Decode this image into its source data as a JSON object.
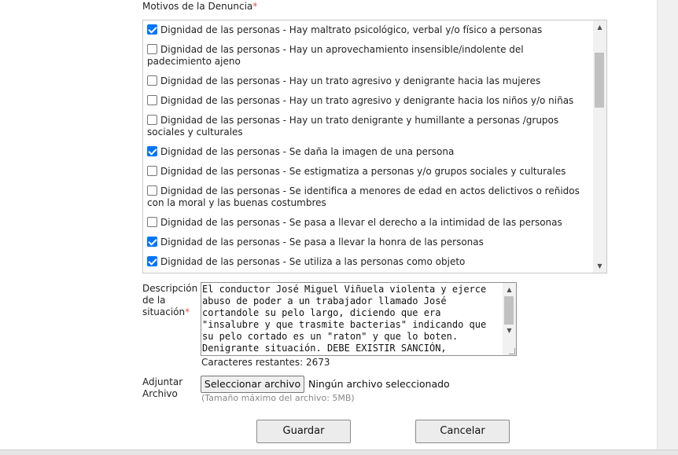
{
  "motivos": {
    "label": "Motivos de la Denuncia",
    "required_mark": "*",
    "items": [
      {
        "label": "Dignidad de las personas - Hay maltrato psicológico, verbal y/o físico a personas",
        "checked": true
      },
      {
        "label": "Dignidad de las personas - Hay un aprovechamiento insensible/indolente del padecimiento ajeno",
        "checked": false
      },
      {
        "label": "Dignidad de las personas - Hay un trato agresivo y denigrante hacia las mujeres",
        "checked": false
      },
      {
        "label": "Dignidad de las personas - Hay un trato agresivo y denigrante hacia los niños y/o niñas",
        "checked": false
      },
      {
        "label": "Dignidad de las personas - Hay un trato denigrante y humillante a personas /grupos sociales y culturales",
        "checked": false
      },
      {
        "label": "Dignidad de las personas - Se daña la imagen de una persona",
        "checked": true
      },
      {
        "label": "Dignidad de las personas - Se estigmatiza a personas y/o grupos sociales y culturales",
        "checked": false
      },
      {
        "label": "Dignidad de las personas - Se identifica a menores de edad en actos delictivos o reñidos con la moral y las buenas costumbres",
        "checked": false
      },
      {
        "label": "Dignidad de las personas - Se pasa a llevar el derecho a la intimidad de las personas",
        "checked": false
      },
      {
        "label": "Dignidad de las personas - Se pasa a llevar la honra de las personas",
        "checked": true
      },
      {
        "label": "Dignidad de las personas - Se utiliza a las personas como objeto",
        "checked": true
      }
    ]
  },
  "descripcion": {
    "label": "Descripción de la situación",
    "required_mark": "*",
    "value": "El conductor José Miguel Viñuela violenta y ejerce abuso de poder a un trabajador llamado José cortandole su pelo largo, diciendo que era \"insalubre y que trasmite bacterias\" indicando que su pelo cortado es un \"raton\" y que lo boten. Denigrante situación. DEBE EXISTIR SANCIÓN,",
    "counter": "Caracteres restantes: 2673"
  },
  "adjuntar": {
    "label": "Adjuntar Archivo",
    "button_label": "Seleccionar archivo",
    "status": "Ningún archivo seleccionado",
    "hint": "(Tamaño máximo del archivo: 5MB)"
  },
  "actions": {
    "save_label": "Guardar",
    "cancel_label": "Cancelar"
  },
  "colors": {
    "required": "#d9534f",
    "checkbox_checked": "#0075ff"
  },
  "icons": {
    "scroll_up": "▲",
    "scroll_down": "▼"
  }
}
